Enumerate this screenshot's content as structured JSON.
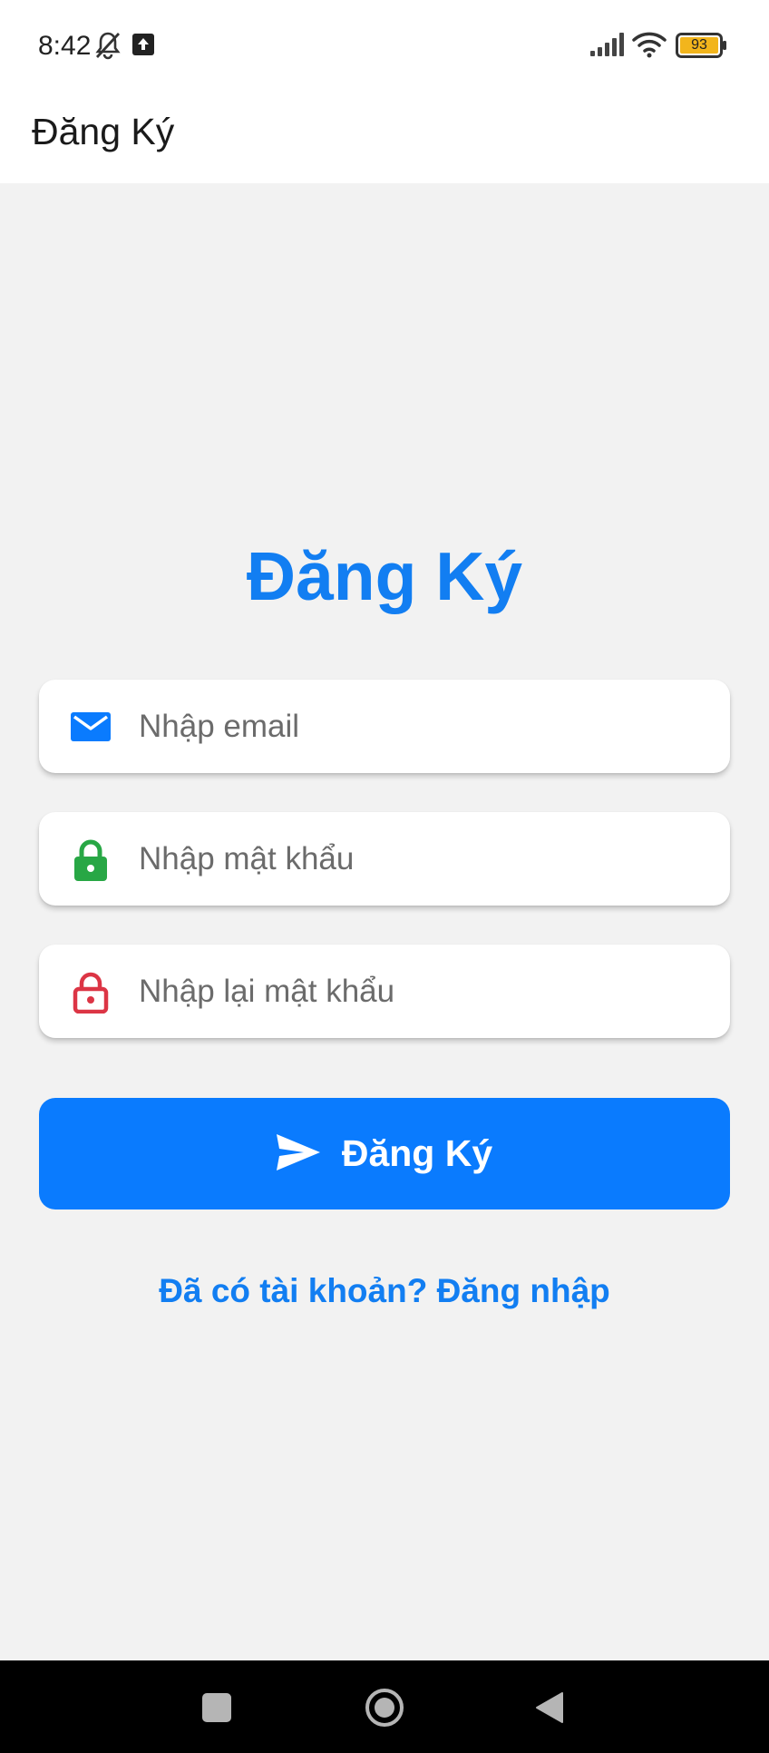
{
  "status_bar": {
    "time": "8:42",
    "battery": "93",
    "icons": [
      "bell-off-icon",
      "upload-icon",
      "signal-icon",
      "wifi-icon",
      "battery-icon"
    ],
    "battery_color": "#f2b51c"
  },
  "app_bar": {
    "title": "Đăng Ký"
  },
  "form": {
    "heading": "Đăng Ký",
    "email_placeholder": "Nhập email",
    "password_placeholder": "Nhập mật khẩu",
    "confirm_placeholder": "Nhập lại mật khẩu",
    "email_icon": "mail-icon",
    "password_icon": "lock-icon",
    "confirm_icon": "lock-open-icon",
    "submit_label": "Đăng Ký",
    "submit_icon": "send-icon",
    "login_link": "Đã có tài khoản? Đăng nhập"
  },
  "colors": {
    "primary": "#0a7bfe",
    "heading": "#127ef2",
    "lock_green": "#28a745",
    "lock_red": "#dc3545",
    "background": "#f2f2f2"
  },
  "nav_bar": {
    "icons": [
      "recents-square-icon",
      "home-circle-icon",
      "back-triangle-icon"
    ]
  }
}
